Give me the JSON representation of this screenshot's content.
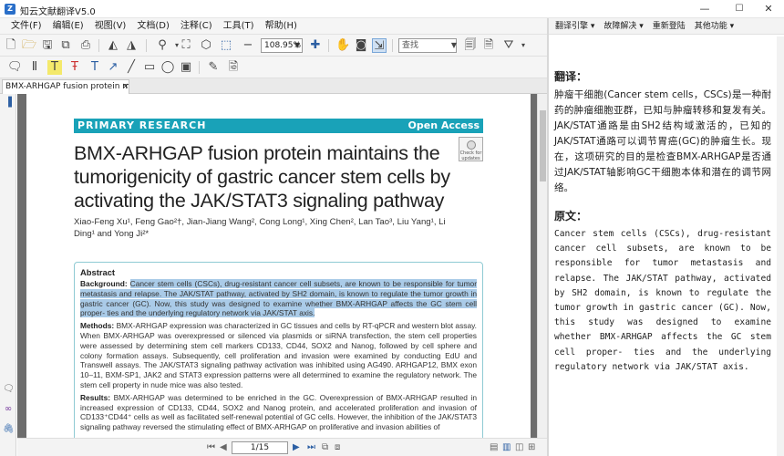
{
  "app": {
    "title": "知云文献翻译V5.0",
    "icon_letter": "Z",
    "min_glyph": "—",
    "max_glyph": "☐",
    "close_glyph": "✕"
  },
  "menu": [
    "文件(F)",
    "编辑(E)",
    "视图(V)",
    "文档(D)",
    "注释(C)",
    "工具(T)",
    "帮助(H)"
  ],
  "toolbar": {
    "zoom_value": "108.95%",
    "search_placeholder": "查找"
  },
  "tab": {
    "label": "BMX-ARHGAP fusion protein m...",
    "close": "×"
  },
  "status": {
    "page_indicator": "1/15"
  },
  "right_panel": {
    "tabs": [
      "翻译引擎 ▾",
      "故障解决 ▾",
      "重新登陆",
      "其他功能 ▾"
    ],
    "translation_heading": "翻译：",
    "translation_text": "肿瘤干细胞(Cancer stem cells，CSCs)是一种耐药的肿瘤细胞亚群，已知与肿瘤转移和复发有关。JAK/STAT通路是由SH2结构域激活的，已知的JAK/STAT通路可以调节胃癌(GC)的肿瘤生长。现在，这项研究的目的是检查BMX-ARHGAP是否通过JAK/STAT轴影响GC干细胞本体和潜在的调节网络。",
    "original_heading": "原文：",
    "original_text": "Cancer stem cells (CSCs), drug-resistant cancer cell subsets, are known to be responsible for tumor metastasis and relapse. The JAK/STAT pathway, activated by SH2 domain, is known to regulate the tumor growth in gastric cancer (GC). Now, this study was designed to examine whether BMX-ARHGAP affects the GC stem cell proper- ties and the underlying regulatory network via JAK/STAT axis."
  },
  "document": {
    "banner_left": "PRIMARY RESEARCH",
    "banner_right": "Open Access",
    "check_badge": "Check for updates",
    "title": "BMX-ARHGAP fusion protein maintains the tumorigenicity of gastric cancer stem cells by activating the JAK/STAT3 signaling pathway",
    "authors": "Xiao-Feng Xu¹, Feng Gao²†, Jian-Jiang Wang², Cong Long¹, Xing Chen², Lan Tao³, Liu Yang¹, Li Ding¹ and Yong Ji²*",
    "abstract_label": "Abstract",
    "background_label": "Background:",
    "background_text": "Cancer stem cells (CSCs), drug-resistant cancer cell subsets, are known to be responsible for tumor metastasis and relapse. The JAK/STAT pathway, activated by SH2 domain, is known to regulate the tumor growth in gastric cancer (GC). Now, this study was designed to examine whether BMX-ARHGAP affects the GC stem cell proper- ties and the underlying regulatory network via JAK/STAT axis.",
    "methods_label": "Methods:",
    "methods_text": "BMX-ARHGAP expression was characterized in GC tissues and cells by RT-qPCR and western blot assay. When BMX-ARHGAP was overexpressed or silenced via plasmids or siRNA transfection, the stem cell properties were assessed by determining stem cell markers CD133, CD44, SOX2 and Nanog, followed by cell sphere and colony formation assays. Subsequently, cell proliferation and invasion were examined by conducting EdU and Transwell assays. The JAK/STAT3 signaling pathway activation was inhibited using AG490. ARHGAP12, BMX exon 10–11, BXM-SP1, JAK2 and STAT3 expression patterns were all determined to examine the regulatory network. The stem cell property in nude mice was also tested.",
    "results_label": "Results:",
    "results_text": "BMX-ARHGAP was determined to be enriched in the GC. Overexpression of BMX-ARHGAP resulted in increased expression of CD133, CD44, SOX2 and Nanog protein, and accelerated proliferation and invasion of CD133⁺CD44⁺ cells as well as facilitated self-renewal potential of GC cells. However, the inhibition of the JAK/STAT3 signaling pathway reversed the stimulating effect of BMX-ARHGAP on proliferative and invasion abilities of"
  }
}
